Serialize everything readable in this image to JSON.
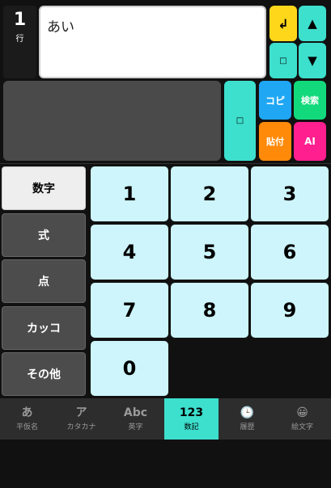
{
  "editor": {
    "line_number": "1",
    "line_unit": "行",
    "text": "あい"
  },
  "buttons": {
    "enter_glyph": "↲",
    "cursor_up_glyph": "▲",
    "cursor_down_glyph": "▼",
    "small_square_glyph": "□",
    "wide_square_glyph": "□",
    "copy_label": "コピ",
    "search_label": "検索",
    "paste_label": "貼付",
    "ai_label": "AI"
  },
  "colors": {
    "accent_teal": "#3ddfcd",
    "accent_yellow": "#ffd71a",
    "copy_blue": "#1fa7f4",
    "search_green": "#12da7c",
    "paste_orange": "#ff8a0a",
    "ai_pink": "#ff1f8f",
    "key_bg": "#cdf5fb"
  },
  "categories": [
    {
      "label": "数字",
      "active": true
    },
    {
      "label": "式",
      "active": false
    },
    {
      "label": "点",
      "active": false
    },
    {
      "label": "カッコ",
      "active": false
    },
    {
      "label": "その他",
      "active": false
    }
  ],
  "keypad": [
    "1",
    "2",
    "3",
    "4",
    "5",
    "6",
    "7",
    "8",
    "9",
    "0"
  ],
  "tabs": [
    {
      "icon": "あ",
      "label": "平仮名"
    },
    {
      "icon": "ア",
      "label": "カタカナ"
    },
    {
      "icon": "Abc",
      "label": "英字"
    },
    {
      "icon": "123",
      "label": "数記"
    },
    {
      "icon": "🕒",
      "label": "履歴"
    },
    {
      "icon": "😀",
      "label": "絵文字"
    }
  ]
}
